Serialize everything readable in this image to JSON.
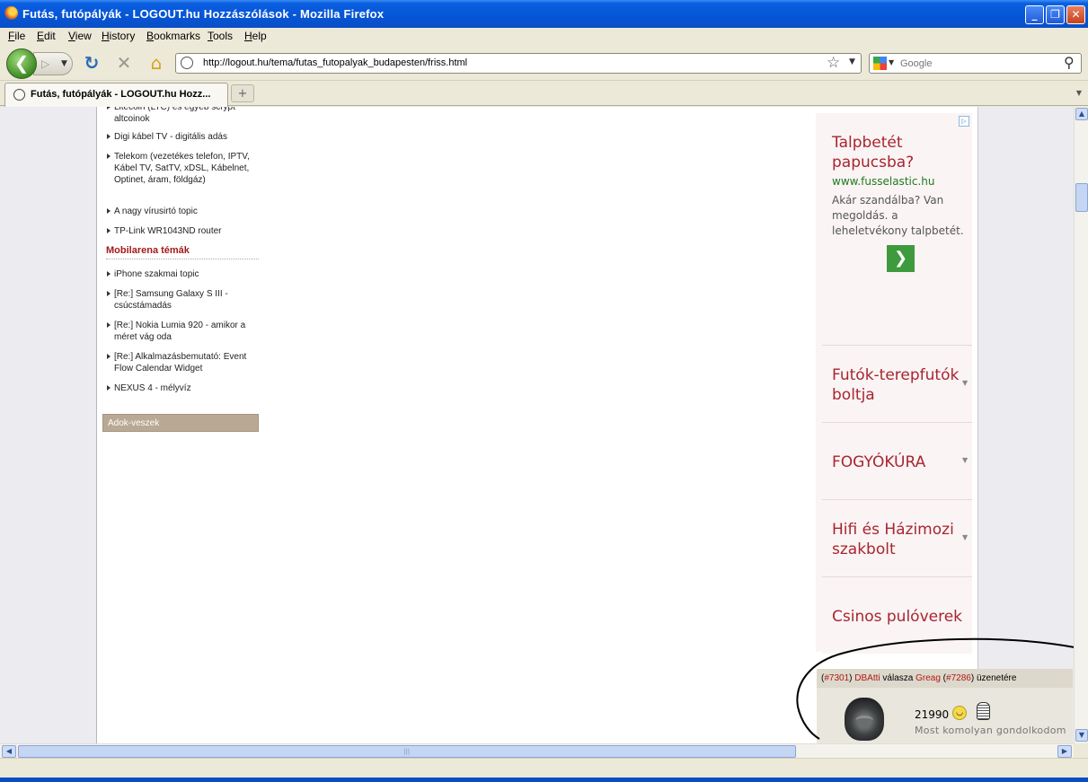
{
  "window": {
    "title": "Futás, futópályák - LOGOUT.hu Hozzászólások - Mozilla Firefox",
    "minimize": "_",
    "maximize": "❐",
    "close": "✕"
  },
  "menu": [
    "File",
    "Edit",
    "View",
    "History",
    "Bookmarks",
    "Tools",
    "Help"
  ],
  "nav": {
    "url": "http://logout.hu/tema/futas_futopalyak_budapesten/friss.html",
    "search_placeholder": "Google"
  },
  "tabs": {
    "active": "Futás, futópályák - LOGOUT.hu Hozz..."
  },
  "sidebar": {
    "topics_top": [
      "Litecoin (LTC) és egyéb scrypt altcoinok",
      "Digi kábel TV - digitális adás",
      "Telekom (vezetékes telefon, IPTV, Kábel TV, SatTV, xDSL, Kábelnet, Optinet, áram, földgáz)",
      "A nagy vírusirtó topic",
      "TP-Link WR1043ND router"
    ],
    "section_heading": "Mobilarena témák",
    "topics_mobil": [
      "iPhone szakmai topic",
      "[Re:] Samsung Galaxy S III - csúcstámadás",
      "[Re:] Nokia Lumia 920 - amikor a méret vág oda",
      "[Re:] Alkalmazásbemutató: Event Flow Calendar Widget",
      "NEXUS 4 - mélyvíz"
    ],
    "adok_veszek": "Adok-veszek"
  },
  "ad": {
    "title": "Talpbetét papucsba?",
    "url": "www.fusselastic.hu",
    "description": "Akár szandálba? Van megoldás. a leheletvékony talpbetét.",
    "links": [
      "Futók-terepfutók boltja",
      "FOGYÓKÚRA",
      "Hifi és Házimozi szakbolt",
      "Csinos pulóverek"
    ]
  },
  "comment": {
    "header_open": "(",
    "post_id": "#7301",
    "header_close_1": ")",
    "author": "DBAtti",
    "reply_word": "válasza",
    "reply_to": "Greag",
    "paren_open": "(",
    "reply_id": "#7286",
    "paren_close": ")",
    "suffix": "üzenetére",
    "count": "21990",
    "text": "Most komolyan gondolkodom"
  }
}
